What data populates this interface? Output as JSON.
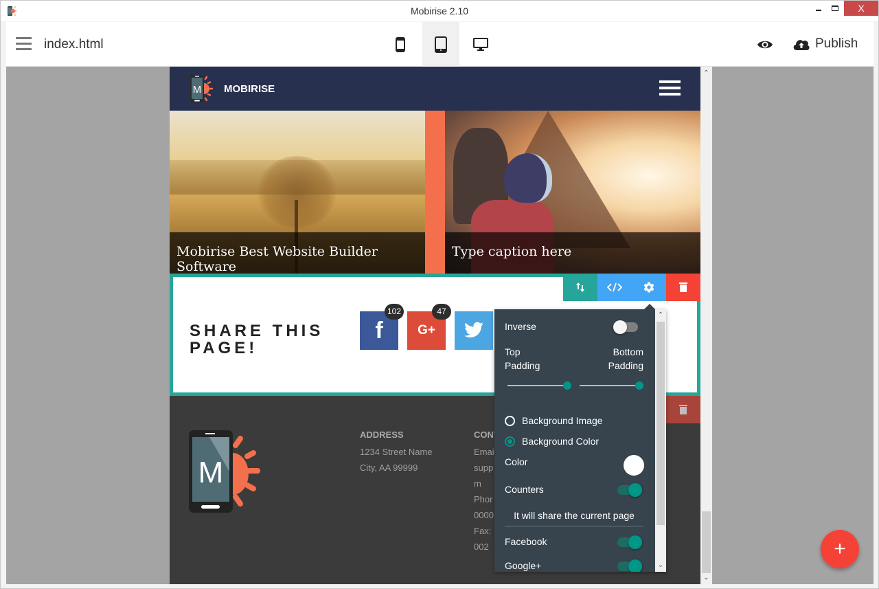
{
  "window": {
    "title": "Mobirise 2.10",
    "controls": {
      "minimize": "minimize",
      "maximize": "maximize",
      "close": "X"
    }
  },
  "toolbar": {
    "file_name": "index.html",
    "devices": [
      {
        "name": "mobile",
        "icon": "mobile-icon",
        "active": false
      },
      {
        "name": "tablet",
        "icon": "tablet-icon",
        "active": true
      },
      {
        "name": "desktop",
        "icon": "desktop-icon",
        "active": false
      }
    ],
    "preview_icon": "eye-icon",
    "publish_label": "Publish",
    "publish_icon": "cloud-upload-icon"
  },
  "site": {
    "nav": {
      "brand": "MOBIRISE",
      "logo_letter": "M",
      "menu_icon": "hamburger-icon"
    },
    "gallery": [
      {
        "caption": "Mobirise Best Website Builder Software"
      },
      {
        "caption": "Type caption here"
      }
    ],
    "share": {
      "title": "SHARE THIS PAGE!",
      "buttons": [
        {
          "network": "Facebook",
          "icon_text": "f",
          "count": "102",
          "color": "#3b5998"
        },
        {
          "network": "Google+",
          "icon_text": "G+",
          "count": "47",
          "color": "#dd4b39"
        },
        {
          "network": "Twitter",
          "icon_text": "",
          "count": null,
          "color": "#4ca6e1"
        }
      ]
    },
    "block_tools": [
      "move-icon",
      "code-icon",
      "gear-icon",
      "trash-icon"
    ],
    "footer": {
      "logo_letter": "M",
      "address": {
        "heading": "ADDRESS",
        "lines": [
          "1234 Street Name",
          "City, AA 99999"
        ]
      },
      "contacts": {
        "heading": "CONT",
        "lines": [
          "Emai",
          "supp",
          "m",
          "Phor",
          "0000",
          "Fax:",
          "002"
        ]
      }
    }
  },
  "settings_panel": {
    "inverse": {
      "label": "Inverse",
      "on": false
    },
    "top_padding": {
      "label_line1": "Top",
      "label_line2": "Padding",
      "value_fraction": 1.0
    },
    "bottom_padding": {
      "label_line1": "Bottom",
      "label_line2": "Padding",
      "value_fraction": 1.0
    },
    "background": {
      "options": [
        {
          "label": "Background Image",
          "checked": false
        },
        {
          "label": "Background Color",
          "checked": true
        }
      ]
    },
    "color": {
      "label": "Color",
      "value": "#ffffff"
    },
    "counters": {
      "label": "Counters",
      "on": true
    },
    "note": "It will share the current page",
    "networks": [
      {
        "label": "Facebook",
        "on": true
      },
      {
        "label": "Google+",
        "on": true
      }
    ]
  },
  "fab": {
    "label": "+"
  },
  "colors": {
    "accent_teal": "#26a69a",
    "toggle_on": "#009688",
    "tool_blue": "#42a5f5",
    "delete_red": "#f44336",
    "nav_dark": "#27304e",
    "gallery_orange": "#f4704d",
    "panel_bg": "#37434d",
    "footer_bg": "#3b3b3b"
  }
}
